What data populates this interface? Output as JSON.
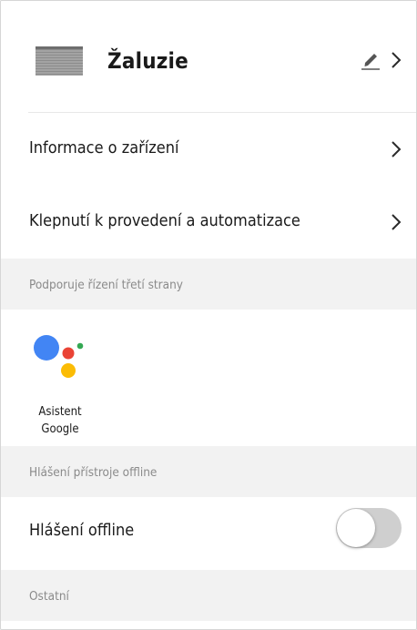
{
  "device": {
    "title": "Žaluzie"
  },
  "rows": {
    "device_info": "Informace o zařízení",
    "tap_automation": "Klepnutí k provedení a automatizace"
  },
  "sections": {
    "third_party": "Podporuje řízení třetí strany",
    "offline_report": "Hlášení přístroje offline",
    "other": "Ostatní"
  },
  "third_party": {
    "assistant_line1": "Asistent",
    "assistant_line2": "Google",
    "colors": [
      "#4285F4",
      "#EA4335",
      "#FBBC05",
      "#34A853"
    ]
  },
  "offline": {
    "label": "Hlášení offline",
    "toggle_on": false
  },
  "icons": [
    "blinds-thumbnail-icon",
    "pencil-edit-icon",
    "chevron-right-icon",
    "google-assistant-icon"
  ]
}
